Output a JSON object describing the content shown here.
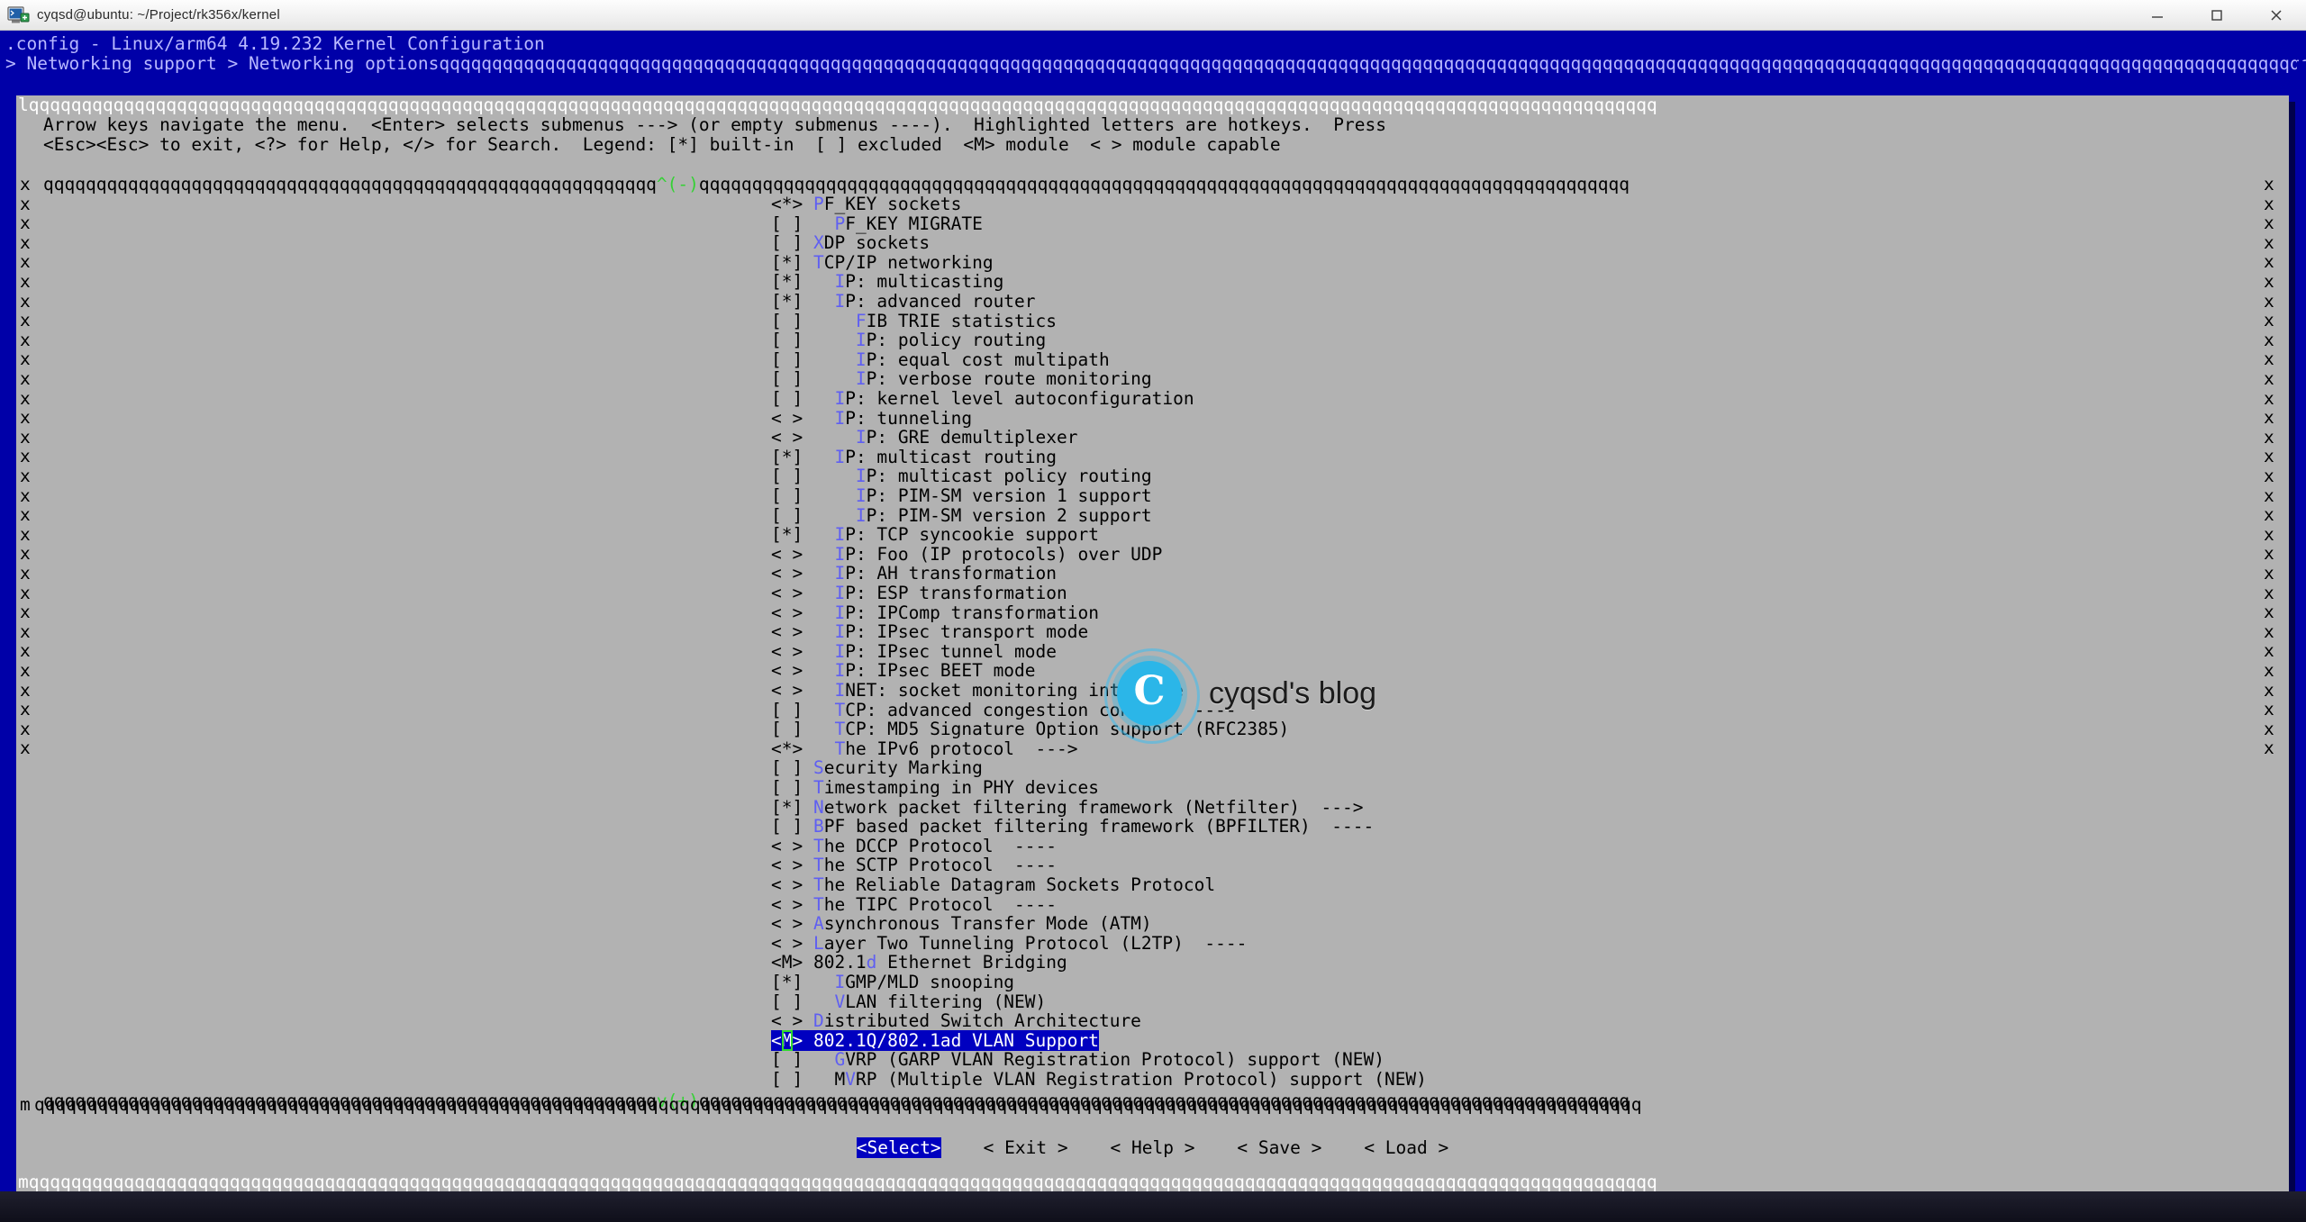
{
  "window": {
    "title": "cyqsd@ubuntu: ~/Project/rk356x/kernel",
    "icon": "terminal-icon",
    "minimize_label": "—",
    "maximize_label": "☐",
    "close_label": "✕"
  },
  "header": {
    "line1": ".config - Linux/arm64 4.19.232 Kernel Configuration",
    "breadcrumb": "> Networking support > Networking options",
    "breadcrumb_fill": "qqqqqqqqqqqqqqqqqqqqqqqqqqqqqqqqqqqqqqqqqqqqqqqqqqqqqqqqqqqqqqqqqqqqqqqqqqqqqqqqqqqqqqqqqqqqqqqqqqqqqqqqqqqqqqqqqqqqqqqqqqqqqqqqqqqqqqqqqqqqqqqqqqqqqqqqqqqqqqqqqqqqqqqqqqqqqqqqqqqqqqqqqqq"
  },
  "dialog": {
    "title": "Networking options",
    "help_line1": "Arrow keys navigate the menu.  <Enter> selects submenus ---> (or empty submenus ----).  Highlighted letters are hotkeys.  Press",
    "help_line2": "<Esc><Esc> to exit, <?> for Help, </> for Search.  Legend: [*] built-in  [ ] excluded  <M> module  < > module capable",
    "scroll_up_indicator": "^(-)",
    "scroll_down_indicator": "v(+)",
    "border_char": "q",
    "side_char": "x",
    "corner_tl": "l",
    "corner_bl": "m"
  },
  "menu": {
    "items": [
      {
        "state": "<*>",
        "indent": 0,
        "hotkey": "P",
        "rest": "F_KEY sockets",
        "selected": false
      },
      {
        "state": "[ ]",
        "indent": 1,
        "hotkey": "P",
        "rest": "F_KEY MIGRATE",
        "selected": false
      },
      {
        "state": "[ ]",
        "indent": 0,
        "hotkey": "X",
        "rest": "DP sockets",
        "selected": false
      },
      {
        "state": "[*]",
        "indent": 0,
        "hotkey": "T",
        "rest": "CP/IP networking",
        "selected": false
      },
      {
        "state": "[*]",
        "indent": 1,
        "hotkey": "I",
        "rest": "P: multicasting",
        "selected": false
      },
      {
        "state": "[*]",
        "indent": 1,
        "hotkey": "I",
        "rest": "P: advanced router",
        "selected": false
      },
      {
        "state": "[ ]",
        "indent": 2,
        "hotkey": "F",
        "rest": "IB TRIE statistics",
        "selected": false
      },
      {
        "state": "[ ]",
        "indent": 2,
        "hotkey": "I",
        "rest": "P: policy routing",
        "selected": false
      },
      {
        "state": "[ ]",
        "indent": 2,
        "hotkey": "I",
        "rest": "P: equal cost multipath",
        "selected": false
      },
      {
        "state": "[ ]",
        "indent": 2,
        "hotkey": "I",
        "rest": "P: verbose route monitoring",
        "selected": false
      },
      {
        "state": "[ ]",
        "indent": 1,
        "hotkey": "I",
        "rest": "P: kernel level autoconfiguration",
        "selected": false
      },
      {
        "state": "< >",
        "indent": 1,
        "hotkey": "I",
        "rest": "P: tunneling",
        "selected": false
      },
      {
        "state": "< >",
        "indent": 2,
        "hotkey": "I",
        "rest": "P: GRE demultiplexer",
        "selected": false
      },
      {
        "state": "[*]",
        "indent": 1,
        "hotkey": "I",
        "rest": "P: multicast routing",
        "selected": false
      },
      {
        "state": "[ ]",
        "indent": 2,
        "hotkey": "I",
        "rest": "P: multicast policy routing",
        "selected": false
      },
      {
        "state": "[ ]",
        "indent": 2,
        "hotkey": "I",
        "rest": "P: PIM-SM version 1 support",
        "selected": false
      },
      {
        "state": "[ ]",
        "indent": 2,
        "hotkey": "I",
        "rest": "P: PIM-SM version 2 support",
        "selected": false
      },
      {
        "state": "[*]",
        "indent": 1,
        "hotkey": "I",
        "rest": "P: TCP syncookie support",
        "selected": false
      },
      {
        "state": "< >",
        "indent": 1,
        "hotkey": "I",
        "rest": "P: Foo (IP protocols) over UDP",
        "selected": false
      },
      {
        "state": "< >",
        "indent": 1,
        "hotkey": "I",
        "rest": "P: AH transformation",
        "selected": false
      },
      {
        "state": "< >",
        "indent": 1,
        "hotkey": "I",
        "rest": "P: ESP transformation",
        "selected": false
      },
      {
        "state": "< >",
        "indent": 1,
        "hotkey": "I",
        "rest": "P: IPComp transformation",
        "selected": false
      },
      {
        "state": "< >",
        "indent": 1,
        "hotkey": "I",
        "rest": "P: IPsec transport mode",
        "selected": false
      },
      {
        "state": "< >",
        "indent": 1,
        "hotkey": "I",
        "rest": "P: IPsec tunnel mode",
        "selected": false
      },
      {
        "state": "< >",
        "indent": 1,
        "hotkey": "I",
        "rest": "P: IPsec BEET mode",
        "selected": false
      },
      {
        "state": "< >",
        "indent": 1,
        "hotkey": "I",
        "rest": "NET: socket monitoring interface",
        "selected": false
      },
      {
        "state": "[ ]",
        "indent": 1,
        "hotkey": "T",
        "rest": "CP: advanced congestion control  ----",
        "selected": false
      },
      {
        "state": "[ ]",
        "indent": 1,
        "hotkey": "T",
        "rest": "CP: MD5 Signature Option support (RFC2385)",
        "selected": false
      },
      {
        "state": "<*>",
        "indent": 1,
        "hotkey": "T",
        "rest": "he IPv6 protocol  --->",
        "selected": false
      },
      {
        "state": "[ ]",
        "indent": 0,
        "hotkey": "S",
        "rest": "ecurity Marking",
        "selected": false
      },
      {
        "state": "[ ]",
        "indent": 0,
        "hotkey": "T",
        "rest": "imestamping in PHY devices",
        "selected": false
      },
      {
        "state": "[*]",
        "indent": 0,
        "hotkey": "N",
        "rest": "etwork packet filtering framework (Netfilter)  --->",
        "selected": false
      },
      {
        "state": "[ ]",
        "indent": 0,
        "hotkey": "B",
        "rest": "PF based packet filtering framework (BPFILTER)  ----",
        "selected": false
      },
      {
        "state": "< >",
        "indent": 0,
        "hotkey": "T",
        "rest": "he DCCP Protocol  ----",
        "selected": false
      },
      {
        "state": "< >",
        "indent": 0,
        "hotkey": "T",
        "rest": "he SCTP Protocol  ----",
        "selected": false
      },
      {
        "state": "< >",
        "indent": 0,
        "hotkey": "T",
        "rest": "he Reliable Datagram Sockets Protocol",
        "selected": false
      },
      {
        "state": "< >",
        "indent": 0,
        "hotkey": "T",
        "rest": "he TIPC Protocol  ----",
        "selected": false
      },
      {
        "state": "< >",
        "indent": 0,
        "hotkey": "A",
        "rest": "synchronous Transfer Mode (ATM)",
        "selected": false
      },
      {
        "state": "< >",
        "indent": 0,
        "hotkey": "L",
        "rest": "ayer Two Tunneling Protocol (L2TP)  ----",
        "selected": false
      },
      {
        "state": "<M>",
        "indent": 0,
        "hotkey": "",
        "rest": "802.1d Ethernet Bridging",
        "selected": false,
        "hotkey_in": "d"
      },
      {
        "state": "[*]",
        "indent": 1,
        "hotkey": "I",
        "rest": "GMP/MLD snooping",
        "selected": false
      },
      {
        "state": "[ ]",
        "indent": 1,
        "hotkey": "V",
        "rest": "LAN filtering (NEW)",
        "selected": false
      },
      {
        "state": "< >",
        "indent": 0,
        "hotkey": "D",
        "rest": "istributed Switch Architecture",
        "selected": false
      },
      {
        "state": "<M>",
        "indent": 0,
        "hotkey": "",
        "rest": "802.1Q/802.1ad VLAN Support",
        "selected": true,
        "cursor_char": "M"
      },
      {
        "state": "[ ]",
        "indent": 1,
        "hotkey": "G",
        "rest": "VRP (GARP VLAN Registration Protocol) support (NEW)",
        "selected": false
      },
      {
        "state": "[ ]",
        "indent": 1,
        "hotkey": "",
        "rest": "MVRP (Multiple VLAN Registration Protocol) support (NEW)",
        "selected": false,
        "hotkey_in": "V"
      }
    ]
  },
  "buttons": [
    {
      "label": "<Select>",
      "selected": true,
      "name": "select-button"
    },
    {
      "label": "< Exit >",
      "selected": false,
      "name": "exit-button"
    },
    {
      "label": "< Help >",
      "selected": false,
      "name": "help-button"
    },
    {
      "label": "< Save >",
      "selected": false,
      "name": "save-button"
    },
    {
      "label": "< Load >",
      "selected": false,
      "name": "load-button"
    }
  ],
  "watermark": {
    "logo_letter": "C",
    "text": "cyqsd's blog"
  },
  "colors": {
    "terminal_bg": "#0000a8",
    "dialog_bg": "#b2b2b2",
    "highlight_bg": "#0000c0",
    "hotkey": "#5f5ff2",
    "scroll_indicator": "#35d135",
    "cursor_outline": "#2fd92f"
  }
}
